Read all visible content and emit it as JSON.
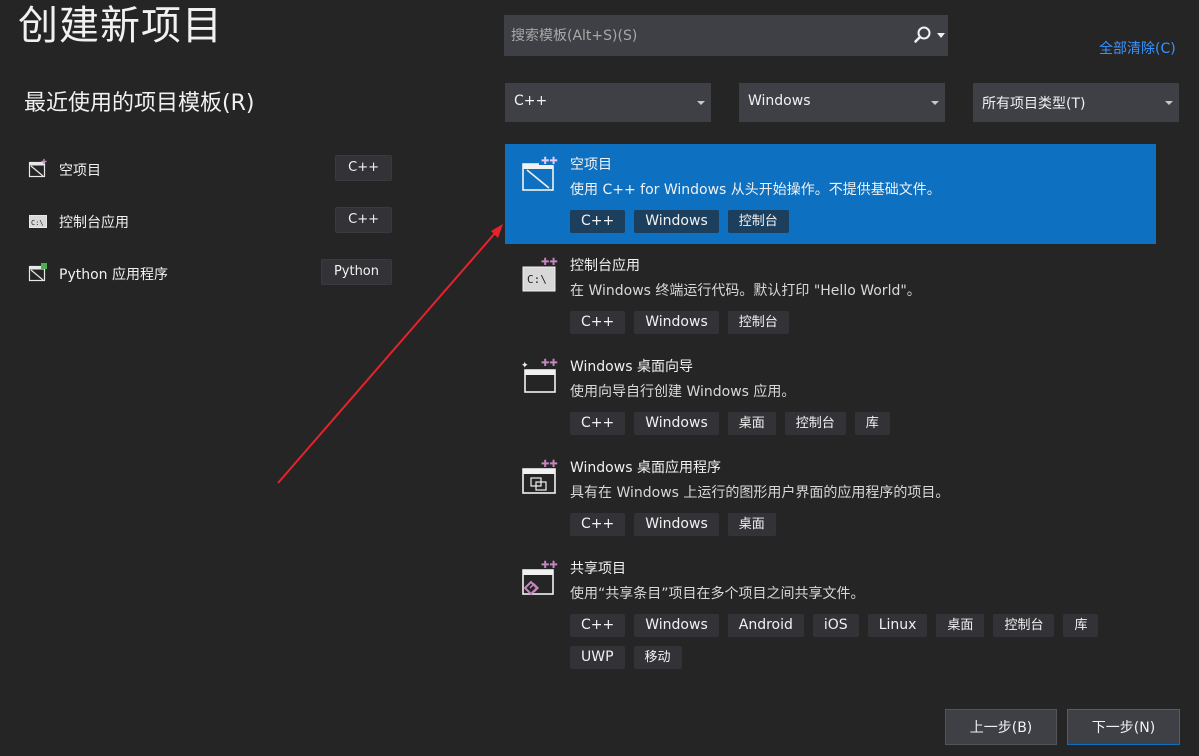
{
  "header": {
    "title": "创建新项目"
  },
  "recent": {
    "title": "最近使用的项目模板(R)",
    "items": [
      {
        "label": "空项目",
        "tag": "C++",
        "icon": "empty-project-icon"
      },
      {
        "label": "控制台应用",
        "tag": "C++",
        "icon": "console-app-icon"
      },
      {
        "label": "Python 应用程序",
        "tag": "Python",
        "icon": "python-app-icon"
      }
    ]
  },
  "search": {
    "placeholder": "搜索模板(Alt+S)(S)"
  },
  "clear_all": "全部清除(C)",
  "filters": {
    "language": "C++",
    "platform": "Windows",
    "project_type": "所有项目类型(T)"
  },
  "templates": [
    {
      "name": "空项目",
      "description": "使用 C++ for Windows 从头开始操作。不提供基础文件。",
      "tags": [
        "C++",
        "Windows",
        "控制台"
      ],
      "selected": true
    },
    {
      "name": "控制台应用",
      "description": "在 Windows 终端运行代码。默认打印 \"Hello World\"。",
      "tags": [
        "C++",
        "Windows",
        "控制台"
      ]
    },
    {
      "name": "Windows 桌面向导",
      "description": "使用向导自行创建 Windows 应用。",
      "tags": [
        "C++",
        "Windows",
        "桌面",
        "控制台",
        "库"
      ]
    },
    {
      "name": "Windows 桌面应用程序",
      "description": "具有在 Windows 上运行的图形用户界面的应用程序的项目。",
      "tags": [
        "C++",
        "Windows",
        "桌面"
      ]
    },
    {
      "name": "共享项目",
      "description": "使用“共享条目”项目在多个项目之间共享文件。",
      "tags": [
        "C++",
        "Windows",
        "Android",
        "iOS",
        "Linux",
        "桌面",
        "控制台",
        "库",
        "UWP",
        "移动"
      ]
    }
  ],
  "buttons": {
    "back": "上一步(B)",
    "next": "下一步(N)"
  },
  "colors": {
    "background": "#252526",
    "selected": "#0e70c0",
    "link": "#3794ff",
    "arrow": "#e8222a"
  }
}
